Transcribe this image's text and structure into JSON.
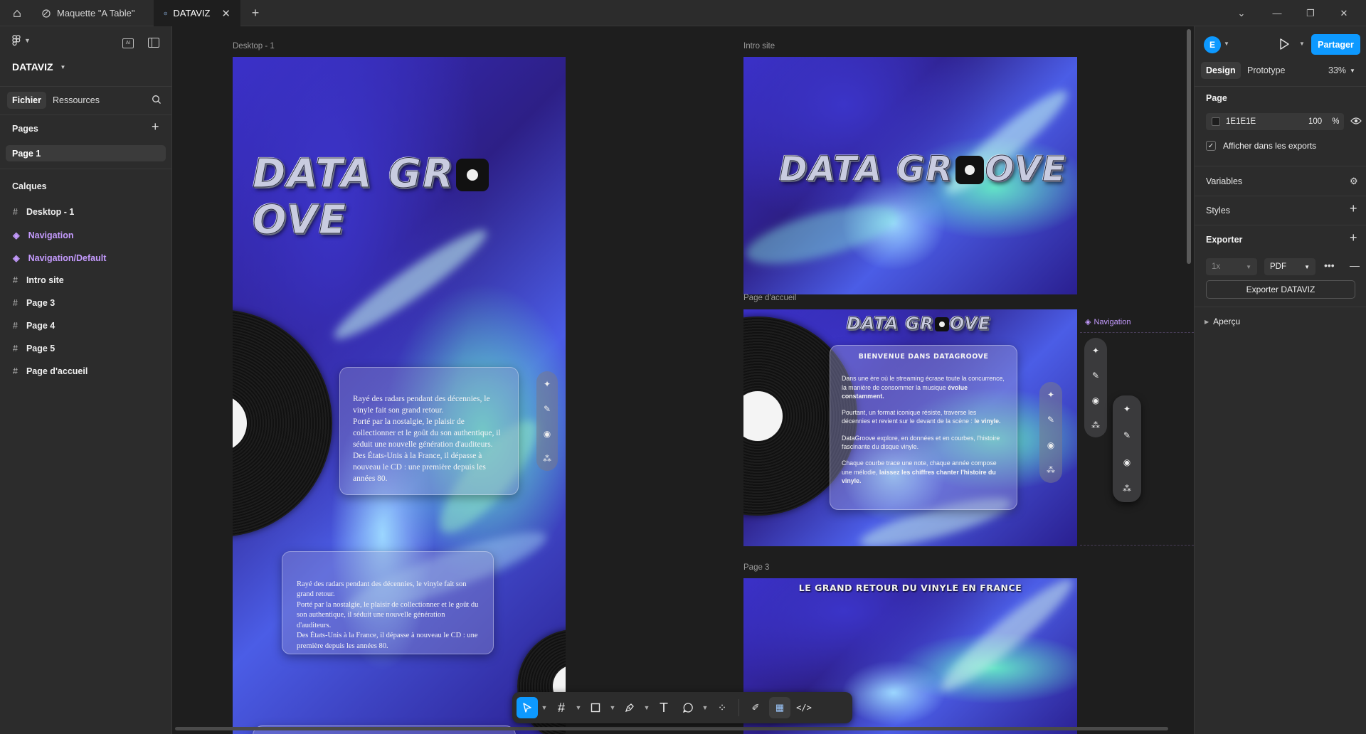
{
  "tabs": [
    {
      "label": "Maquette \"A Table\""
    },
    {
      "label": "DATAVIZ"
    }
  ],
  "left_panel": {
    "file_name": "DATAVIZ",
    "subtabs": {
      "file": "Fichier",
      "resources": "Ressources"
    },
    "pages_heading": "Pages",
    "pages": [
      "Page 1"
    ],
    "layers_heading": "Calques",
    "layers": [
      {
        "name": "Desktop - 1",
        "type": "frame"
      },
      {
        "name": "Navigation",
        "type": "component"
      },
      {
        "name": "Navigation/Default",
        "type": "component"
      },
      {
        "name": "Intro site",
        "type": "frame"
      },
      {
        "name": "Page 3",
        "type": "frame"
      },
      {
        "name": "Page 4",
        "type": "frame"
      },
      {
        "name": "Page 5",
        "type": "frame"
      },
      {
        "name": "Page d'accueil",
        "type": "frame"
      }
    ]
  },
  "canvas": {
    "frame_labels": {
      "desktop": "Desktop - 1",
      "intro": "Intro site",
      "accueil": "Page d'accueil",
      "page3": "Page 3",
      "navigation": "Navigation"
    },
    "logo_text": {
      "left": "DATA GR",
      "right": "OVE"
    },
    "desktop_card1": "Rayé des radars pendant des décennies, le vinyle fait son grand retour.\nPorté par la nostalgie, le plaisir de collectionner et le goût du son authentique, il séduit une nouvelle génération d'auditeurs.\nDes États-Unis à la France, il dépasse à nouveau le CD : une première depuis les années 80.",
    "desktop_card2": "Rayé des radars pendant des décennies, le vinyle fait son grand retour.\nPorté par la nostalgie, le plaisir de collectionner et le goût du son authentique, il séduit une nouvelle génération d'auditeurs.\nDes États-Unis à la France, il dépasse à nouveau le CD : une première depuis les années 80.",
    "welcome_title": "BIENVENUE DANS DATAGROOVE",
    "welcome_p1a": "Dans une ère où le streaming écrase toute la concurrence, la manière de consommer la musique ",
    "welcome_p1b": "évolue constamment.",
    "welcome_p2a": "Pourtant, un format iconique résiste, traverse les décennies et revient sur le devant de la scène : ",
    "welcome_p2b": "le vinyle.",
    "welcome_p3": "DataGroove explore, en données et en courbes, l'histoire fascinante du disque vinyle.",
    "welcome_p4a": "Chaque courbe trace une note, chaque année compose une mélodie, ",
    "welcome_p4b": "laissez les chiffres chanter l'histoire du vinyle.",
    "page3_title": "LE GRAND RETOUR DU VINYLE EN FRANCE"
  },
  "right_panel": {
    "avatar": "E",
    "share": "Partager",
    "tabs": {
      "design": "Design",
      "prototype": "Prototype"
    },
    "zoom": "33%",
    "page_heading": "Page",
    "page_color": "1E1E1E",
    "page_opacity": "100",
    "percent": "%",
    "show_exports": "Afficher dans les exports",
    "variables": "Variables",
    "styles": "Styles",
    "export_heading": "Exporter",
    "export_scale": "1x",
    "export_format": "PDF",
    "export_button": "Exporter DATAVIZ",
    "preview": "Aperçu"
  },
  "help": "?",
  "colors": {
    "accent": "#0d99ff",
    "component": "#c59bff",
    "panel": "#2c2c2c",
    "canvas": "#1e1e1e"
  }
}
